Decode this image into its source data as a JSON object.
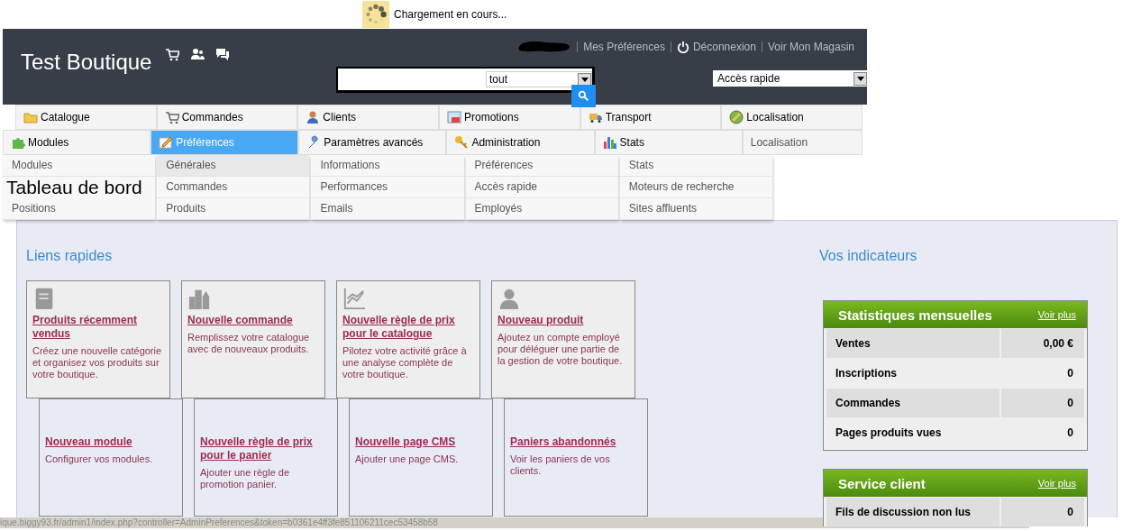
{
  "loading": {
    "text": "Chargement en cours..."
  },
  "header": {
    "title": "Test Boutique",
    "links": [
      "Mes Préférences",
      "Déconnexion",
      "Voir Mon Magasin"
    ],
    "search_scope": "tout",
    "quick_access": "Accès rapide"
  },
  "nav": {
    "primary": [
      {
        "label": "Catalogue",
        "selected": false
      },
      {
        "label": "Commandes",
        "selected": false
      },
      {
        "label": "Clients",
        "selected": false
      },
      {
        "label": "Promotions",
        "selected": false
      },
      {
        "label": "Transport",
        "selected": false
      },
      {
        "label": "Localisation",
        "selected": false
      }
    ],
    "secondary": [
      {
        "label": "Modules",
        "selected": false
      },
      {
        "label": "Préférences",
        "selected": true
      },
      {
        "label": "Paramètres avancés",
        "selected": false
      },
      {
        "label": "Administration",
        "selected": false
      },
      {
        "label": "Stats",
        "selected": false
      },
      {
        "label": "Localisation",
        "selected": false
      }
    ]
  },
  "dropdown": [
    {
      "items": [
        {
          "label": "Modules",
          "selected": false
        },
        {
          "label": "Positions",
          "selected": false
        }
      ]
    },
    {
      "items": [
        {
          "label": "Générales",
          "selected": true
        },
        {
          "label": "Commandes",
          "selected": false
        },
        {
          "label": "Produits",
          "selected": false
        }
      ]
    },
    {
      "items": [
        {
          "label": "Informations",
          "selected": false
        },
        {
          "label": "Performances",
          "selected": false
        },
        {
          "label": "Emails",
          "selected": false
        }
      ]
    },
    {
      "items": [
        {
          "label": "Préférences",
          "selected": false
        },
        {
          "label": "Accès rapide",
          "selected": false
        },
        {
          "label": "Employés",
          "selected": false
        }
      ]
    },
    {
      "items": [
        {
          "label": "Stats",
          "selected": false
        },
        {
          "label": "Moteurs de recherche",
          "selected": false
        },
        {
          "label": "Sites affluents",
          "selected": false
        }
      ]
    }
  ],
  "page_title": "Tableau de bord",
  "quick_links": {
    "title": "Liens rapides",
    "rows": [
      {
        "cards": [
          {
            "title": "Produits récemment vendus",
            "description": "Créez une nouvelle catégorie et organisez vos produits sur votre boutique."
          },
          {
            "title": "Nouvelle commande",
            "description": "Remplissez votre catalogue avec de nouveaux produits."
          },
          {
            "title": "Nouvelle règle de prix pour le catalogue",
            "description": "Pilotez votre activité grâce à une analyse complète de votre boutique."
          },
          {
            "title": "Nouveau produit",
            "description": "Ajoutez un compte employé pour déléguer une partie de la gestion de votre boutique."
          }
        ]
      },
      {
        "cards": [
          {
            "title": "Nouveau module",
            "description": "Configurer vos modules."
          },
          {
            "title": "Nouvelle règle de prix pour le panier",
            "description": "Ajouter une règle de promotion panier."
          },
          {
            "title": "Nouvelle page CMS",
            "description": "Ajouter une page CMS."
          },
          {
            "title": "Paniers abandonnés",
            "description": "Voir les paniers de vos clients."
          }
        ]
      }
    ]
  },
  "indicators": {
    "title": "Vos indicateurs",
    "panels": [
      {
        "title": "Statistiques mensuelles",
        "link": "Voir plus",
        "rows": [
          {
            "label": "Ventes",
            "value": "0,00 €"
          },
          {
            "label": "Inscriptions",
            "value": "0"
          },
          {
            "label": "Commandes",
            "value": "0"
          },
          {
            "label": "Pages produits vues",
            "value": "0"
          }
        ]
      },
      {
        "title": "Service client",
        "link": "Voir plus",
        "rows": [
          {
            "label": "Fils de discussion non lus",
            "value": "0"
          }
        ]
      }
    ]
  },
  "status_bar": {
    "url": "ique.biggy93.fr/admin1/index.php?controller=AdminPreferences&token=b0361e4ff3fe851106211cec53458b58"
  }
}
